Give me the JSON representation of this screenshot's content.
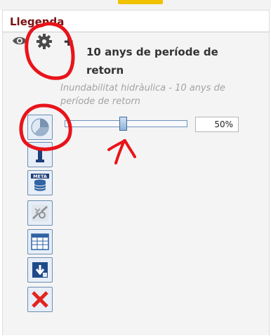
{
  "panel": {
    "title": "Llegenda"
  },
  "layer": {
    "title": "10 anys de període de retorn",
    "description": "Inundabilitat hidràulica - 10 anys de període de retorn"
  },
  "opacity_slider": {
    "value_label": "50%",
    "value": 0.5
  },
  "toolbar": {
    "buttons": [
      {
        "icon": "opacity-icon"
      },
      {
        "icon": "info-icon"
      },
      {
        "icon": "metadata-icon",
        "label": "META"
      },
      {
        "icon": "zoom-icon"
      },
      {
        "icon": "table-icon"
      },
      {
        "icon": "download-icon"
      },
      {
        "icon": "remove-icon"
      }
    ]
  },
  "colors": {
    "title_color": "#7a1212",
    "annotation_red": "#e8141a",
    "button_border": "#6b8fb5",
    "button_fill": "#e7eef8"
  }
}
